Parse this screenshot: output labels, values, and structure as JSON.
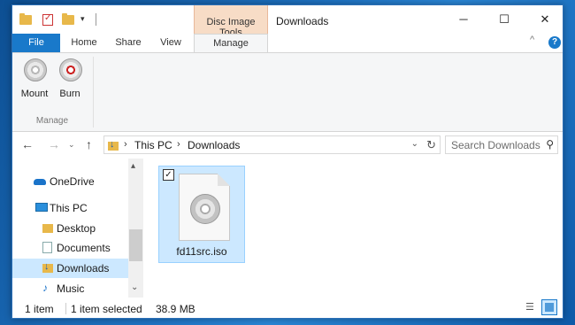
{
  "window": {
    "title": "Downloads",
    "context_tab_group": "Disc Image Tools",
    "caption_buttons": [
      "─",
      "☐",
      "✕"
    ]
  },
  "quick_access": {
    "dropdown": "▾"
  },
  "ribbon": {
    "tabs": {
      "file": "File",
      "home": "Home",
      "share": "Share",
      "view": "View",
      "manage": "Manage"
    },
    "buttons": {
      "mount": "Mount",
      "burn": "Burn"
    },
    "group_label": "Manage",
    "collapse": "^",
    "help": "?"
  },
  "navigation": {
    "back": "←",
    "forward": "→",
    "recent": "⌄",
    "up": "↑",
    "breadcrumb": [
      "This PC",
      "Downloads"
    ],
    "breadcrumb_sep": "›",
    "address_dropdown": "⌄",
    "refresh": "↻",
    "search_placeholder": "Search Downloads",
    "search_icon": "⚲"
  },
  "nav_pane": {
    "items": [
      {
        "label": "OneDrive",
        "icon": "cloud-icon"
      },
      {
        "label": "This PC",
        "icon": "computer-icon"
      },
      {
        "label": "Desktop",
        "icon": "folder-icon"
      },
      {
        "label": "Documents",
        "icon": "documents-icon"
      },
      {
        "label": "Downloads",
        "icon": "downloads-icon",
        "selected": true
      },
      {
        "label": "Music",
        "icon": "music-icon"
      }
    ],
    "scroll_up": "▴",
    "scroll_down": "⌄"
  },
  "content": {
    "files": [
      {
        "name": "fd11src.iso",
        "selected": true,
        "checked": "✓"
      }
    ]
  },
  "status_bar": {
    "item_count": "1 item",
    "selection": "1 item selected",
    "size": "38.9 MB"
  },
  "colors": {
    "accent": "#1979ca",
    "selection": "#cce8ff",
    "context_tab": "#f7dcc6"
  }
}
